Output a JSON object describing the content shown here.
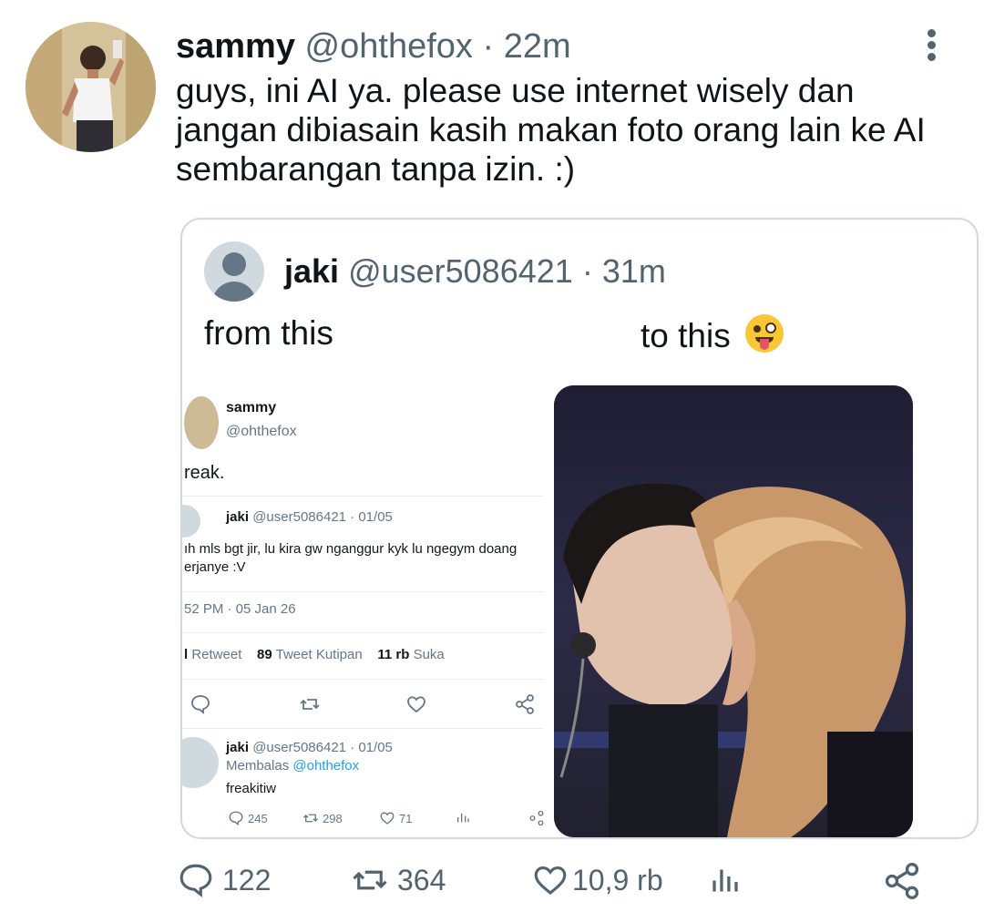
{
  "tweet": {
    "name": "sammy",
    "handle": "@ohthefox",
    "separator": "·",
    "time": "22m",
    "text": "guys, ini AI ya. please use internet wisely dan jangan dibiasain kasih makan foto orang lain ke AI sembarangan tanpa izin. :)",
    "avatar_icon": "profile-photo",
    "more_icon": "more-vertical-icon"
  },
  "quote": {
    "name": "jaki",
    "handle": "@user5086421",
    "separator": "·",
    "time": "31m",
    "text_left": "from this",
    "text_right": "to this",
    "emoji": "winking-face-with-tongue",
    "screenshot": {
      "name": "sammy",
      "handle": "@ohthefox",
      "text": "reak.",
      "reply": {
        "name": "jaki",
        "handle": "@user5086421 · 01/05",
        "text": "ıh mls bgt jir, lu kira gw nganggur kyk lu ngegym doang\nerjanye :V"
      },
      "timestamp": "52 PM · 05 Jan 26",
      "stats": {
        "retweet_count": "l",
        "retweet_label": "Retweet",
        "quote_count": "89",
        "quote_label": "Tweet Kutipan",
        "like_count": "11 rb",
        "like_label": "Suka"
      },
      "reply2": {
        "name": "jaki",
        "handle": "@user5086421 · 01/05",
        "replying_prefix": "Membalas",
        "replying_to": "@ohthefox",
        "text": "freakitiw",
        "replies": "245",
        "retweets": "298",
        "likes": "71"
      }
    },
    "photo_icon": "ai-generated-photo"
  },
  "actions": {
    "reply_count": "122",
    "retweet_count": "364",
    "like_count": "10,9 rb"
  },
  "colors": {
    "text": "#0f1419",
    "secondary": "#536471",
    "border": "#cfd9de",
    "link": "#1da1f2"
  }
}
